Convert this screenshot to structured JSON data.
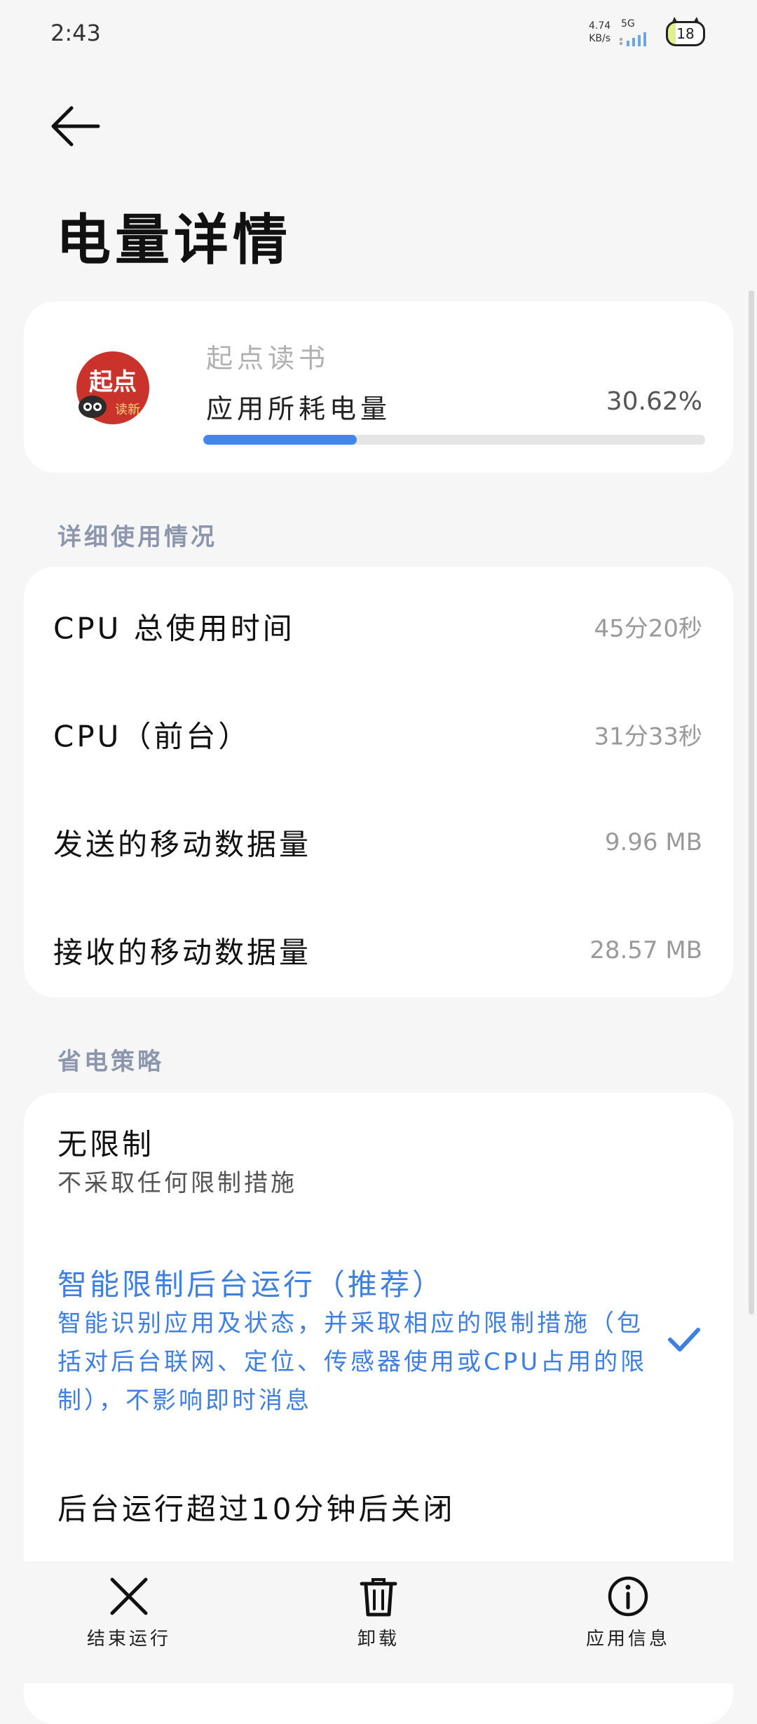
{
  "status_bar": {
    "time": "2:43",
    "net_speed_value": "4.74",
    "net_speed_unit": "KB/s",
    "network_type": "5G",
    "battery_level": "18"
  },
  "header": {
    "title": "电量详情"
  },
  "app": {
    "name": "起点读书",
    "usage_label": "应用所耗电量",
    "usage_percent_text": "30.62%",
    "usage_fraction": 0.3062,
    "icon": "qidian-app-icon"
  },
  "details": {
    "header": "详细使用情况",
    "rows": [
      {
        "label": "CPU 总使用时间",
        "value": "45分20秒"
      },
      {
        "label": "CPU（前台）",
        "value": "31分33秒"
      },
      {
        "label": "发送的移动数据量",
        "value": "9.96 MB"
      },
      {
        "label": "接收的移动数据量",
        "value": "28.57 MB"
      }
    ]
  },
  "power_policy": {
    "header": "省电策略",
    "options": [
      {
        "title": "无限制",
        "description": "不采取任何限制措施",
        "selected": false
      },
      {
        "title": "智能限制后台运行（推荐）",
        "description": "智能识别应用及状态，并采取相应的限制措施（包括对后台联网、定位、传感器使用或CPU占用的限制），不影响即时消息",
        "selected": true
      },
      {
        "title": "后台运行超过10分钟后关闭",
        "description": "",
        "selected": false
      }
    ]
  },
  "bottom_actions": [
    {
      "label": "结束运行",
      "icon": "close-icon"
    },
    {
      "label": "卸载",
      "icon": "trash-icon"
    },
    {
      "label": "应用信息",
      "icon": "info-icon"
    }
  ],
  "colors": {
    "accent": "#3f86f1",
    "section_header": "#8c97ad",
    "background": "#f6f6f6"
  }
}
